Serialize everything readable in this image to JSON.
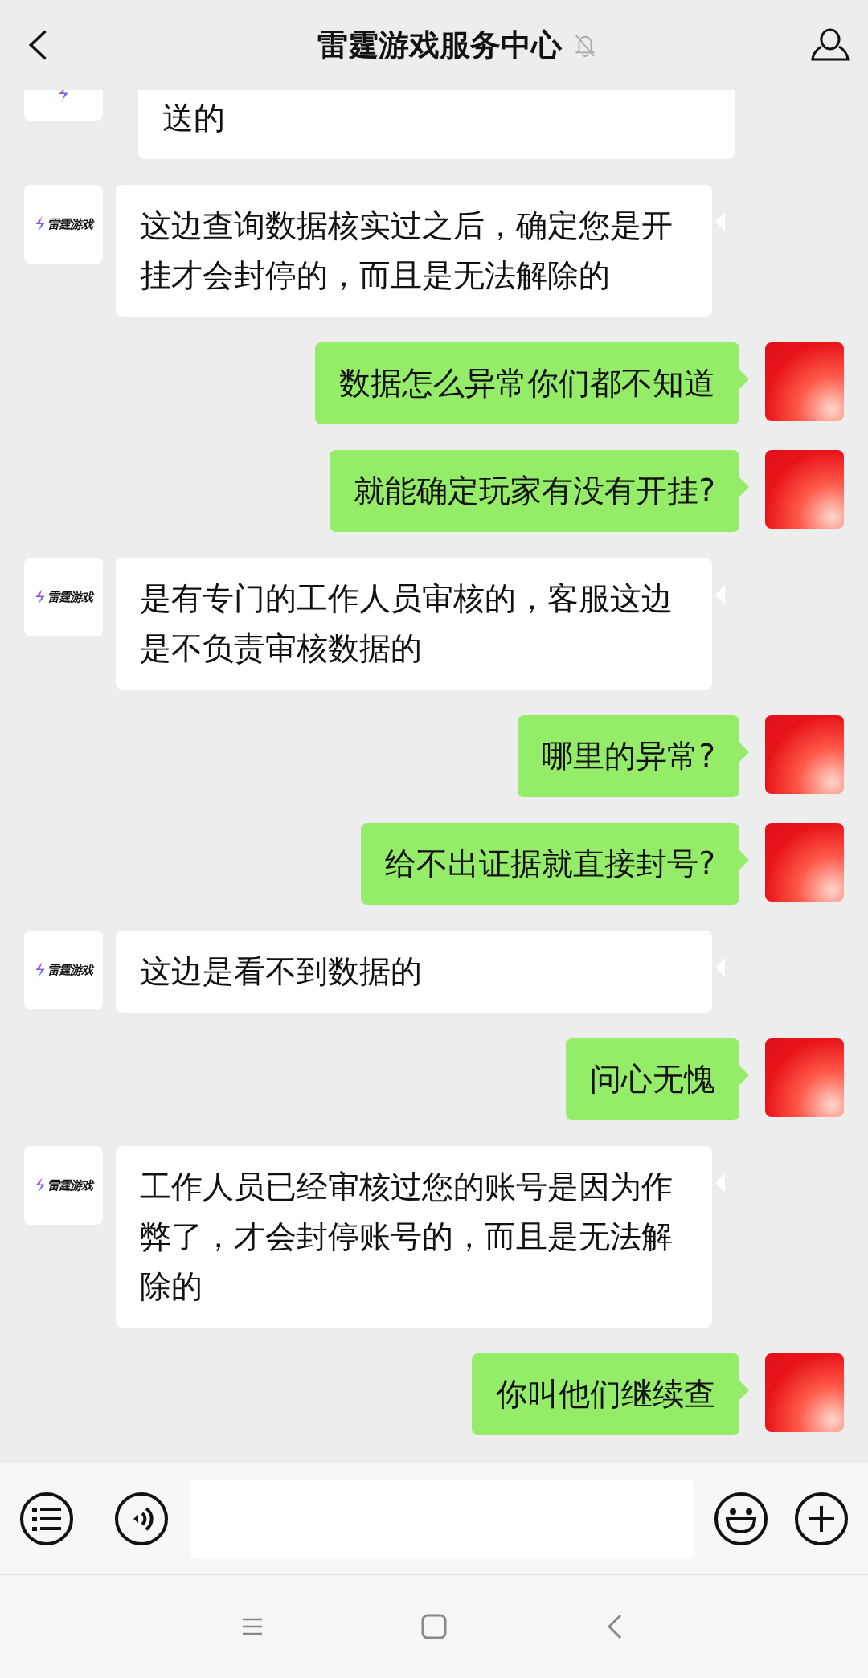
{
  "header": {
    "title": "雷霆游戏服务中心",
    "muted": true
  },
  "messages": [
    {
      "kind": "incoming",
      "cut_top": true,
      "text": "送的"
    },
    {
      "kind": "incoming",
      "logo_text": "雷霆游戏",
      "text": "这边查询数据核实过之后，确定您是开挂才会封停的，而且是无法解除的"
    },
    {
      "kind": "outgoing",
      "text": "数据怎么异常你们都不知道"
    },
    {
      "kind": "outgoing",
      "text": "就能确定玩家有没有开挂?"
    },
    {
      "kind": "incoming",
      "logo_text": "雷霆游戏",
      "text": "是有专门的工作人员审核的，客服这边是不负责审核数据的"
    },
    {
      "kind": "outgoing",
      "text": "哪里的异常?"
    },
    {
      "kind": "outgoing",
      "text": "给不出证据就直接封号?"
    },
    {
      "kind": "incoming",
      "logo_text": "雷霆游戏",
      "text": "这边是看不到数据的"
    },
    {
      "kind": "outgoing",
      "text": "问心无愧"
    },
    {
      "kind": "incoming",
      "logo_text": "雷霆游戏",
      "text": "工作人员已经审核过您的账号是因为作弊了，才会封停账号的，而且是无法解除的"
    },
    {
      "kind": "outgoing",
      "text": "你叫他们继续查"
    }
  ]
}
